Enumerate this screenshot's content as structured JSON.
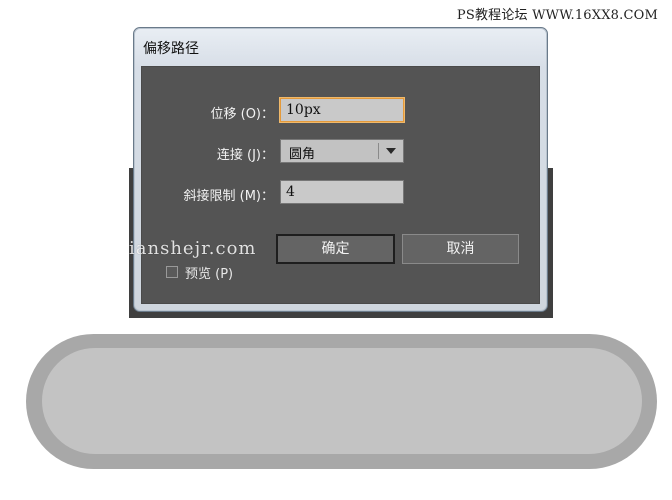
{
  "watermark_top": "PS教程论坛 WWW.16XX8.COM",
  "watermark_mid": "ianshejr.com",
  "dialog": {
    "title": "偏移路径",
    "offset": {
      "label": "位移 (O)：",
      "value": "10px"
    },
    "joins": {
      "label": "连接 (J)：",
      "selected": "圆角"
    },
    "miter_limit": {
      "label": "斜接限制 (M)：",
      "value": "4"
    },
    "preview": {
      "label": "预览 (P)",
      "checked": false
    },
    "ok_label": "确定",
    "cancel_label": "取消"
  },
  "colors": {
    "dialog_body": "#545454",
    "input_focus": "#e49a3b",
    "pill_outer": "#a8a8a8",
    "pill_inner": "#c3c3c3"
  }
}
